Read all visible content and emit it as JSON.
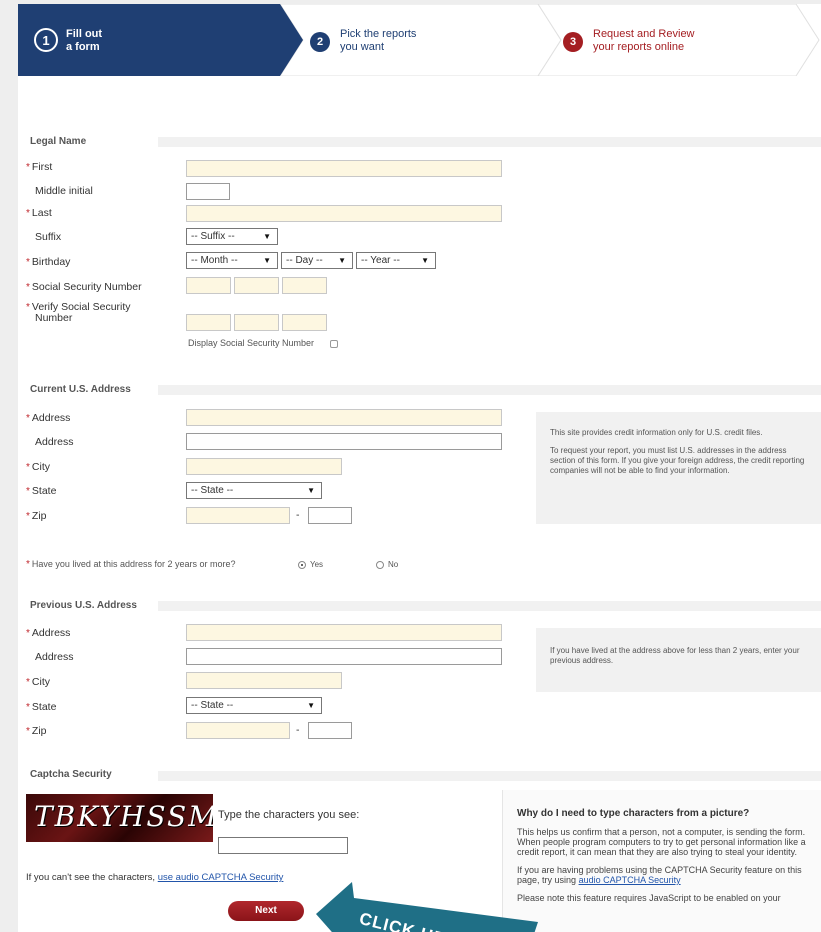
{
  "steps": [
    {
      "num": "1",
      "line1": "Fill out",
      "line2": "a form"
    },
    {
      "num": "2",
      "line1": "Pick the reports",
      "line2": "you want"
    },
    {
      "num": "3",
      "line1": "Request and Review",
      "line2": "your reports online"
    }
  ],
  "legal": {
    "title": "Legal Name",
    "first": "First",
    "middle": "Middle initial",
    "last": "Last",
    "suffix": "Suffix",
    "suffix_select": "-- Suffix --",
    "birthday": "Birthday",
    "month": "-- Month --",
    "day": "-- Day --",
    "year": "-- Year --",
    "ssn": "Social Security Number",
    "verify_ssn_1": "Verify Social Security",
    "verify_ssn_2": "Number",
    "display_ssn": "Display Social Security Number"
  },
  "current": {
    "title": "Current U.S. Address",
    "address": "Address",
    "address2": "Address",
    "city": "City",
    "state": "State",
    "state_select": "-- State --",
    "zip": "Zip",
    "zip_dash": "-",
    "info1": "This site provides credit information only for U.S. credit files.",
    "info2": "To request your report, you must list U.S. addresses in the address section of this form. If you give your foreign address, the credit reporting companies will not be able to find your information.",
    "lived_question": "Have you lived at this address for 2 years or more?",
    "yes": "Yes",
    "no": "No"
  },
  "previous": {
    "title": "Previous U.S. Address",
    "address": "Address",
    "address2": "Address",
    "city": "City",
    "state": "State",
    "state_select": "-- State --",
    "zip": "Zip",
    "zip_dash": "-",
    "info": "If you have lived at the address above for less than 2 years, enter your previous address."
  },
  "captcha": {
    "title": "Captcha Security",
    "image_text": "TBKYHSSM",
    "prompt": "Type the characters you see:",
    "cant_see": "If you can't see the characters,",
    "audio_link": "use audio CAPTCHA Security",
    "next": "Next",
    "why_title": "Why do I need to type characters from a picture?",
    "why1": "This helps us confirm that a person, not a computer, is sending the form. When people program computers to try to get personal information like a credit report, it can mean that they are also trying to steal your identity.",
    "why2a": "If you are having problems using the CAPTCHA Security feature on this page, try using",
    "why2_link": "audio CAPTCHA Security",
    "why3": "Please note this feature requires JavaScript to be enabled on your"
  },
  "callout": "CLICK HERE",
  "colors": {
    "brand_navy": "#1f3f73",
    "accent_red": "#c0272d",
    "field_yellow": "#fdf7e1"
  }
}
